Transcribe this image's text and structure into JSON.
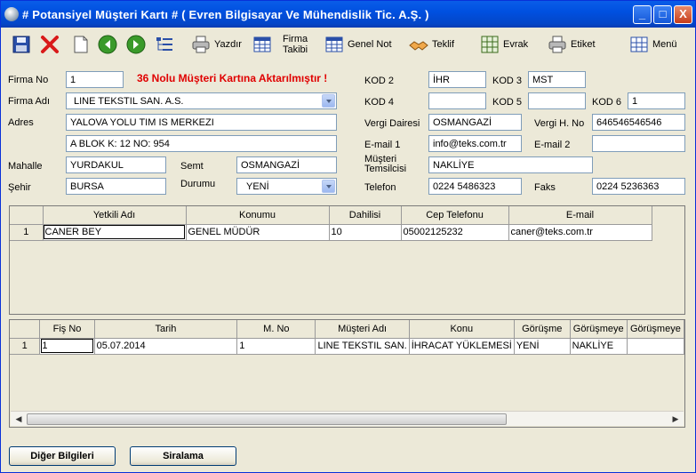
{
  "window": {
    "title": "# Potansiyel Müşteri Kartı #  ( Evren Bilgisayar Ve Mühendislik Tic. A.Ş. )",
    "minimize": "_",
    "maximize": "□",
    "close": "X"
  },
  "toolbar": {
    "yazdir": "Yazdır",
    "firma_takibi_1": "Firma",
    "firma_takibi_2": "Takibi",
    "genel_not": "Genel Not",
    "teklif": "Teklif",
    "evrak": "Evrak",
    "etiket": "Etiket",
    "menu": "Menü"
  },
  "form": {
    "alert": "36 Nolu Müşteri Kartına Aktarılmıştır !",
    "firma_no_label": "Firma No",
    "firma_no": "1",
    "firma_adi_label": "Firma Adı",
    "firma_adi": "LINE TEKSTIL SAN. A.S.",
    "adres_label": "Adres",
    "adres1": "YALOVA YOLU TIM IS MERKEZI",
    "adres2": "A BLOK K: 12 NO: 954",
    "mahalle_label": "Mahalle",
    "mahalle": "YURDAKUL",
    "semt_label": "Semt",
    "semt": "OSMANGAZİ",
    "sehir_label": "Şehir",
    "sehir": "BURSA",
    "durumu_label": "Durumu",
    "durumu": "YENİ",
    "kod2_label": "KOD 2",
    "kod2": "İHR",
    "kod3_label": "KOD 3",
    "kod3": "MST",
    "kod4_label": "KOD 4",
    "kod4": "",
    "kod5_label": "KOD 5",
    "kod5": "",
    "kod6_label": "KOD 6",
    "kod6": "1",
    "vergi_dairesi_label": "Vergi Dairesi",
    "vergi_dairesi": "OSMANGAZİ",
    "vergi_no_label": "Vergi H. No",
    "vergi_no": "646546546546",
    "email1_label": "E-mail 1",
    "email1": "info@teks.com.tr",
    "email2_label": "E-mail 2",
    "email2": "",
    "temsilci_label_1": "Müşteri",
    "temsilci_label_2": "Temsilcisi",
    "temsilci": "NAKLİYE",
    "telefon_label": "Telefon",
    "telefon": "0224 5486323",
    "faks_label": "Faks",
    "faks": "0224 5236363"
  },
  "contacts": {
    "headers": [
      "",
      "Yetkili Adı",
      "Konumu",
      "Dahilisi",
      "Cep Telefonu",
      "E-mail"
    ],
    "rows": [
      [
        "1",
        "CANER BEY",
        "GENEL MÜDÜR",
        "10",
        "05002125232",
        "caner@teks.com.tr"
      ]
    ]
  },
  "meetings": {
    "headers": [
      "",
      "Fiş No",
      "Tarih",
      "M. No",
      "Müşteri Adı",
      "Konu",
      "Görüşme",
      "Görüşmeye",
      "Görüşmeye"
    ],
    "rows": [
      [
        "1",
        "1",
        "05.07.2014",
        "1",
        "LINE TEKSTIL SAN.",
        "İHRACAT YÜKLEMESİ",
        "YENİ",
        "NAKLİYE",
        ""
      ]
    ]
  },
  "buttons": {
    "diger": "Diğer Bilgileri",
    "siralama": "Siralama"
  },
  "colors": {
    "title_bar": "#0050e0",
    "alert": "#e00000",
    "window_bg": "#ece9d8"
  }
}
